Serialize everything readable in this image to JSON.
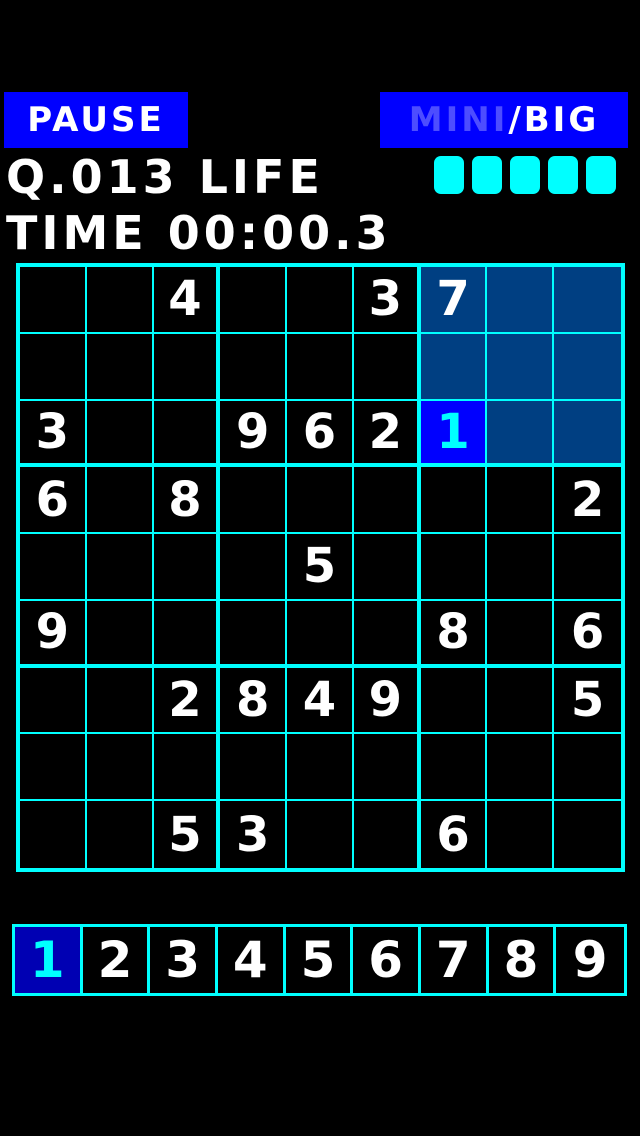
{
  "header": {
    "pause_label": "PAUSE",
    "size_mini": "MINI",
    "size_sep": "/",
    "size_big": "BIG"
  },
  "status": {
    "question_label": "Q.013",
    "life_label": "LIFE",
    "life_count": 5,
    "time_label": "TIME",
    "time_value": "00:00.3"
  },
  "board": {
    "rows": [
      [
        "",
        "",
        "4",
        "",
        "",
        "3",
        "7",
        "",
        ""
      ],
      [
        "",
        "",
        "",
        "",
        "",
        "",
        "",
        "",
        ""
      ],
      [
        "3",
        "",
        "",
        "9",
        "6",
        "2",
        "1",
        "",
        ""
      ],
      [
        "6",
        "",
        "8",
        "",
        "",
        "",
        "",
        "",
        "2"
      ],
      [
        "",
        "",
        "",
        "",
        "5",
        "",
        "",
        "",
        ""
      ],
      [
        "9",
        "",
        "",
        "",
        "",
        "",
        "8",
        "",
        "6"
      ],
      [
        "",
        "",
        "2",
        "8",
        "4",
        "9",
        "",
        "",
        "5"
      ],
      [
        "",
        "",
        "",
        "",
        "",
        "",
        "",
        "",
        ""
      ],
      [
        "",
        "",
        "5",
        "3",
        "",
        "",
        "6",
        "",
        ""
      ]
    ],
    "selected": {
      "row": 3,
      "col": 7
    },
    "highlight_box": {
      "row": 1,
      "col": 3
    }
  },
  "numpad": {
    "keys": [
      "1",
      "2",
      "3",
      "4",
      "5",
      "6",
      "7",
      "8",
      "9"
    ],
    "active": "1"
  },
  "colors": {
    "background": "#000000",
    "grid_line": "#00ffff",
    "button": "#0000ff",
    "box_highlight": "#003f82",
    "selected_cell": "#0000ff",
    "selected_digit": "#00ffff",
    "life_block": "#00ffff"
  }
}
